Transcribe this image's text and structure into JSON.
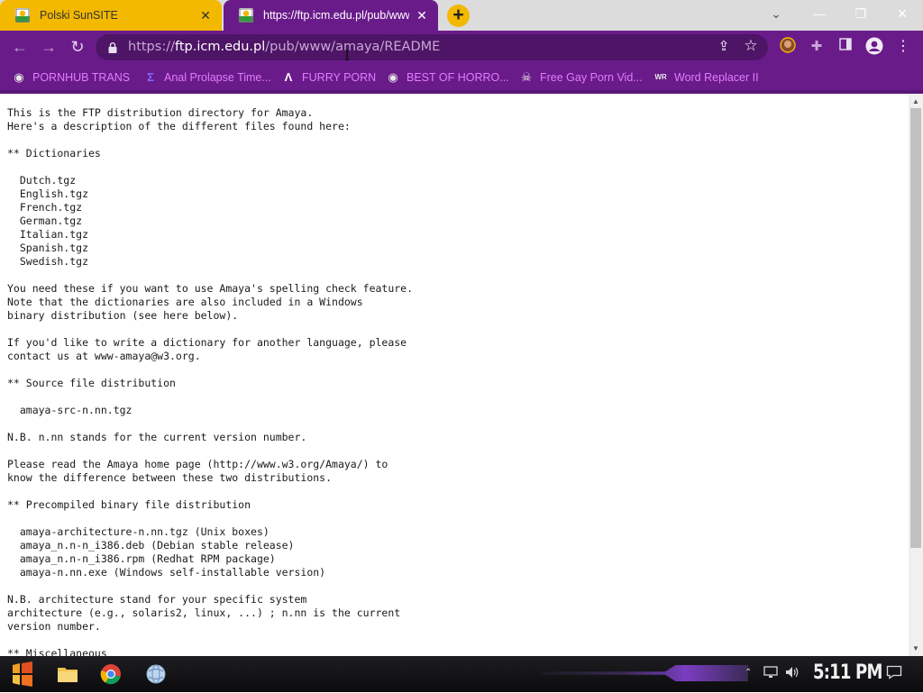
{
  "browser": {
    "tabs": [
      {
        "title": "Polski SunSITE",
        "active": false
      },
      {
        "title": "https://ftp.icm.edu.pl/pub/www/",
        "active": true
      }
    ],
    "new_tab": "+",
    "window_controls": {
      "minimize": "—",
      "restore": "❐",
      "close": "✕",
      "tab_search": "⌄"
    },
    "address": {
      "scheme": "https://",
      "host": "ftp.icm.edu.pl",
      "path": "/pub/www/amaya/README"
    },
    "toolbar_icons": [
      "back-icon",
      "forward-icon",
      "reload-icon",
      "lock-icon",
      "share-icon",
      "star-icon",
      "avatar-icon",
      "extensions-icon",
      "side-panel-icon",
      "profile-icon",
      "menu-icon"
    ],
    "bookmarks": [
      {
        "label": "PORNHUB TRANS",
        "icon": "globe-icon"
      },
      {
        "label": "Anal Prolapse Time...",
        "icon": "sigma-icon"
      },
      {
        "label": "FURRY PORN",
        "icon": "lambda-icon"
      },
      {
        "label": "BEST OF HORRO...",
        "icon": "globe-icon"
      },
      {
        "label": "Free Gay Porn Vid...",
        "icon": "skull-icon"
      },
      {
        "label": "Word Replacer II",
        "icon": "wr-icon"
      }
    ]
  },
  "page": {
    "text": "This is the FTP distribution directory for Amaya.\nHere's a description of the different files found here:\n\n** Dictionaries\n\n  Dutch.tgz\n  English.tgz\n  French.tgz\n  German.tgz\n  Italian.tgz\n  Spanish.tgz\n  Swedish.tgz\n\nYou need these if you want to use Amaya's spelling check feature.\nNote that the dictionaries are also included in a Windows\nbinary distribution (see here below).\n\nIf you'd like to write a dictionary for another language, please\ncontact us at www-amaya@w3.org.\n\n** Source file distribution\n\n  amaya-src-n.nn.tgz\n\nN.B. n.nn stands for the current version number.\n\nPlease read the Amaya home page (http://www.w3.org/Amaya/) to\nknow the difference between these two distributions.\n\n** Precompiled binary file distribution\n\n  amaya-architecture-n.nn.tgz (Unix boxes)\n  amaya_n.n-n_i386.deb (Debian stable release)\n  amaya_n.n-n_i386.rpm (Redhat RPM package)\n  amaya-n.nn.exe (Windows self-installable version)\n\nN.B. architecture stand for your specific system\narchitecture (e.g., solaris2, linux, ...) ; n.nn is the current\nversion number.\n\n** Miscellaneous"
  },
  "taskbar": {
    "apps": [
      "start-icon",
      "file-explorer-icon",
      "chrome-icon",
      "internet-explorer-icon"
    ],
    "tray_icons": [
      "tray-chevron-icon",
      "network-icon",
      "volume-icon"
    ],
    "clock": "5:11 PM",
    "notification": "notification-icon"
  },
  "colors": {
    "theme_purple": "#6a1b8a",
    "tab_yellow": "#f3b800",
    "bookmark_text": "#e27bff"
  }
}
